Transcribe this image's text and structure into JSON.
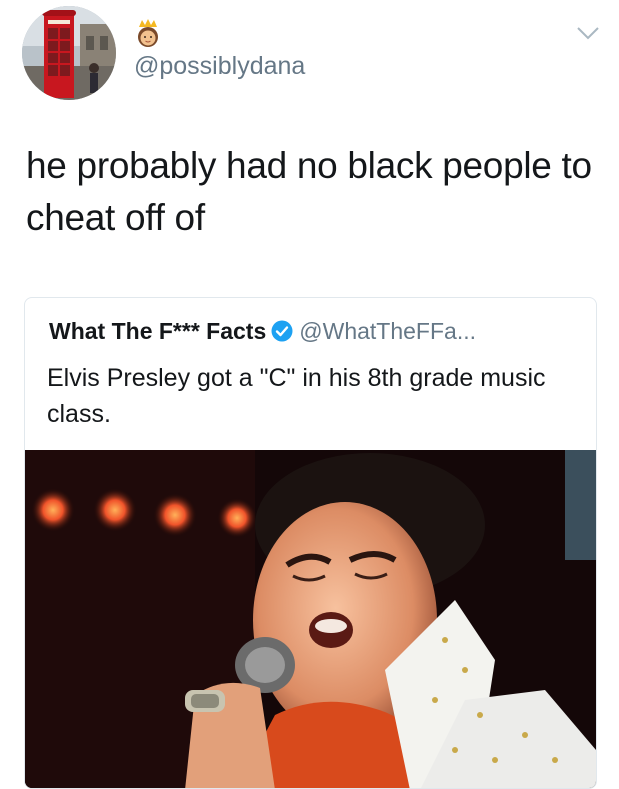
{
  "tweet": {
    "author_handle": "@possiblydana",
    "author_emoji": "princess-emoji",
    "text": "he probably had no black people to cheat off of",
    "menu_icon": "chevron-down-icon"
  },
  "quote": {
    "name": "What The F*** Facts",
    "verified_icon": "verified-badge-icon",
    "handle": "@WhatTheFFa...",
    "text": "Elvis Presley got a \"C\" in his 8th grade music class.",
    "image": "elvis-singing-photo"
  },
  "colors": {
    "text_primary": "#14171a",
    "text_secondary": "#657786",
    "verified_blue": "#1da1f2",
    "card_border": "#e1e8ed"
  }
}
